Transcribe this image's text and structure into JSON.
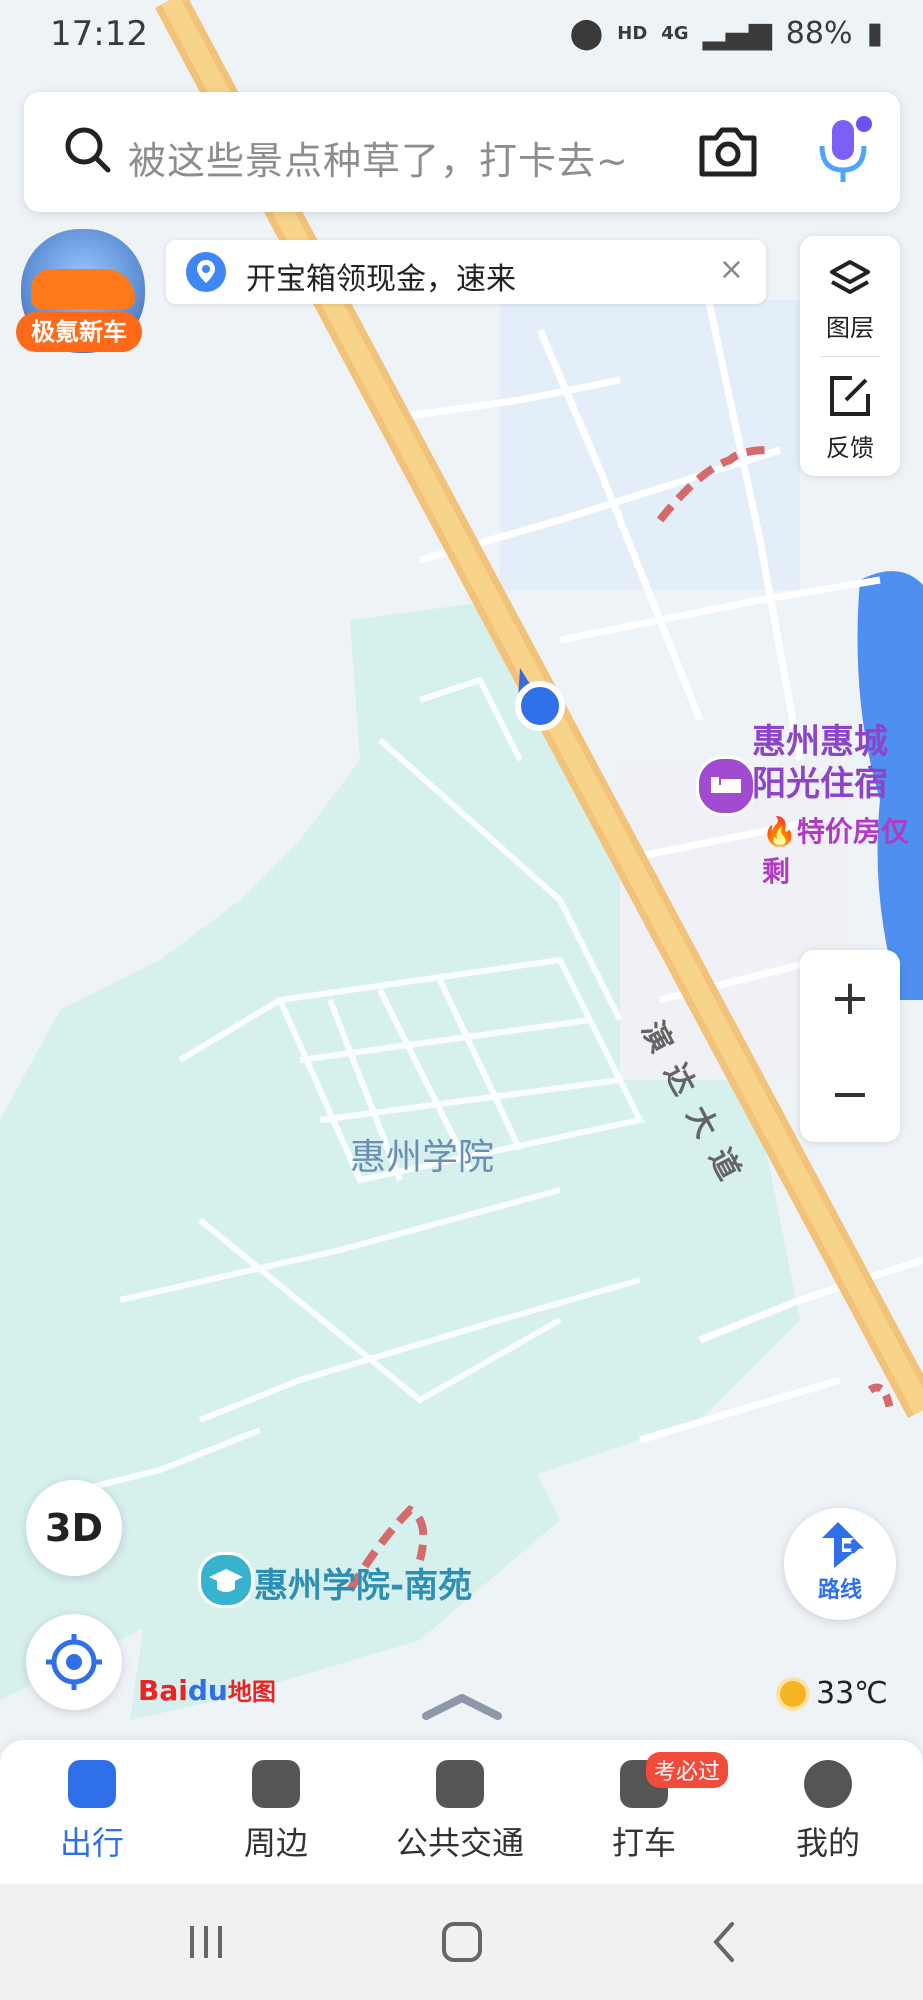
{
  "status_bar": {
    "time": "17:12",
    "network": "4G",
    "hd": "HD",
    "battery": "88%"
  },
  "search": {
    "placeholder": "被这些景点种草了，打卡去~",
    "camera_icon": "camera-icon",
    "voice_icon": "microphone-icon"
  },
  "promo": {
    "label": "极氪新车"
  },
  "notice": {
    "text": "开宝箱领现金，速来",
    "close": "×"
  },
  "tools": {
    "layers_label": "图层",
    "feedback_label": "反馈"
  },
  "zoom": {
    "in": "+",
    "out": "−"
  },
  "map": {
    "poi_hotel_line1": "惠州惠城",
    "poi_hotel_line2": "阳光住宿",
    "poi_hotel_tag": "特价房仅剩",
    "road_name": "演达大道",
    "campus_name": "惠州学院",
    "campus_south": "惠州学院-南苑"
  },
  "controls": {
    "btn_3d": "3D",
    "route_label": "路线"
  },
  "branding": {
    "logo_bai": "Bai",
    "logo_du": "du",
    "logo_text": "地图"
  },
  "weather": {
    "temp": "33℃"
  },
  "bottom_nav": {
    "items": [
      {
        "label": "出行"
      },
      {
        "label": "周边"
      },
      {
        "label": "公共交通"
      },
      {
        "label": "打车"
      },
      {
        "label": "我的"
      }
    ],
    "badge": "考必过"
  },
  "colors": {
    "accent": "#2f6fe8",
    "road": "#f7c867",
    "campus": "#d6f0ee",
    "water": "#4f8ff0",
    "hotel": "#a14bd1"
  }
}
